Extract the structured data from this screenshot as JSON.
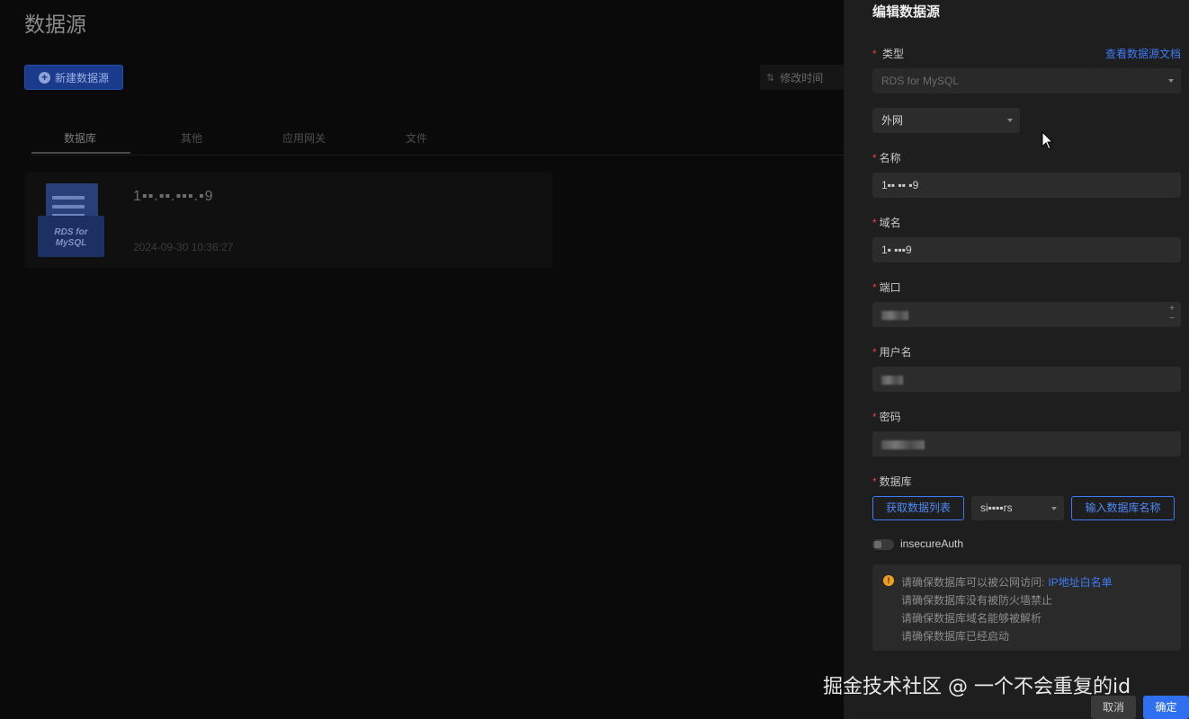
{
  "page": {
    "title": "数据源",
    "new_button": "新建数据源",
    "sort_label": "修改时间"
  },
  "tabs": [
    {
      "label": "数据库"
    },
    {
      "label": "其他"
    },
    {
      "label": "应用网关"
    },
    {
      "label": "文件"
    }
  ],
  "card": {
    "logo_line1": "RDS for",
    "logo_line2": "MySQL",
    "name": "1▪▪.▪▪.▪▪▪.▪9",
    "time": "2024-09-30 10:36:27"
  },
  "panel": {
    "title": "编辑数据源",
    "doc_link": "查看数据源文档",
    "type_label": "类型",
    "type_value": "RDS for MySQL",
    "network_value": "外网",
    "name_label": "名称",
    "name_value": "1▪▪ ▪▪ ▪9",
    "host_label": "域名",
    "host_value": "1▪ ▪▪▪9",
    "port_label": "端口",
    "username_label": "用户名",
    "password_label": "密码",
    "database_label": "数据库",
    "fetch_list_button": "获取数据列表",
    "db_select_value": "si▪▪▪▪rs",
    "enter_db_button": "输入数据库名称",
    "insecure_label": "insecureAuth",
    "notice": {
      "line1": "请确保数据库可以被公网访问:",
      "line1_link": "IP地址白名单",
      "line2": "请确保数据库没有被防火墙禁止",
      "line3": "请确保数据库域名能够被解析",
      "line4": "请确保数据库已经启动"
    },
    "cancel_button": "取消",
    "ok_button": "确定"
  },
  "watermark": "掘金技术社区 @ 一个不会重复的id",
  "required_mark": "*"
}
